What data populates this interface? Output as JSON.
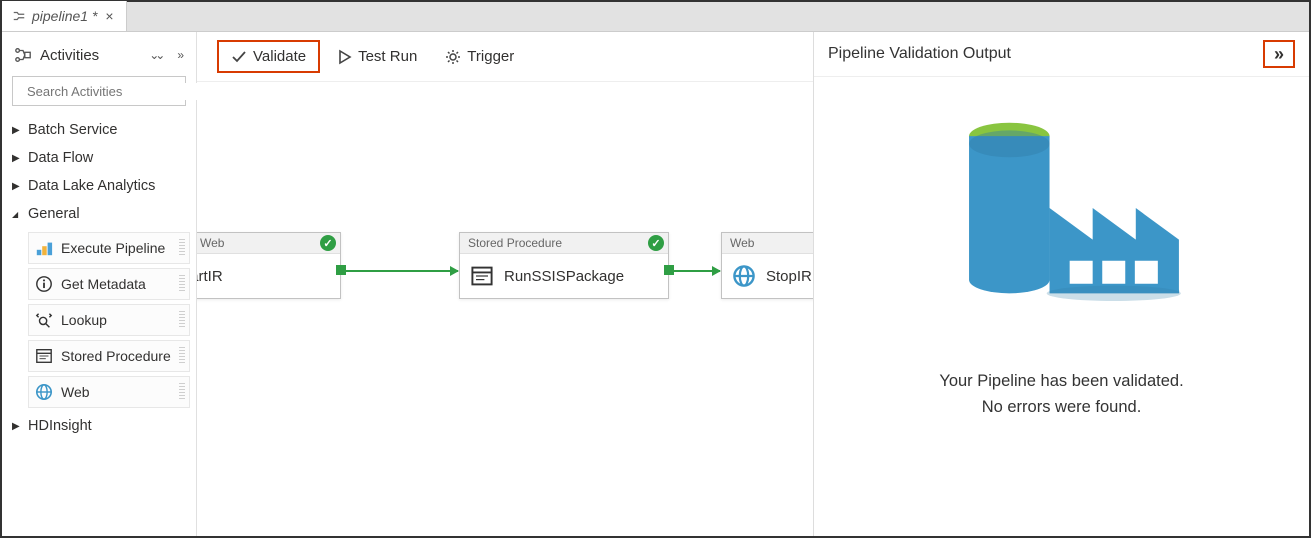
{
  "tab": {
    "title": "pipeline1 *"
  },
  "sidebar": {
    "title": "Activities",
    "search_placeholder": "Search Activities",
    "groups": [
      {
        "label": "Batch Service",
        "expanded": false
      },
      {
        "label": "Data Flow",
        "expanded": false
      },
      {
        "label": "Data Lake Analytics",
        "expanded": false
      },
      {
        "label": "General",
        "expanded": true
      },
      {
        "label": "HDInsight",
        "expanded": false
      }
    ],
    "general_items": [
      {
        "label": "Execute Pipeline",
        "icon": "execute-pipeline-icon"
      },
      {
        "label": "Get Metadata",
        "icon": "info-icon"
      },
      {
        "label": "Lookup",
        "icon": "lookup-icon"
      },
      {
        "label": "Stored Procedure",
        "icon": "stored-procedure-icon"
      },
      {
        "label": "Web",
        "icon": "web-icon"
      }
    ]
  },
  "toolbar": {
    "validate_label": "Validate",
    "testrun_label": "Test Run",
    "trigger_label": "Trigger"
  },
  "nodes": [
    {
      "type_label": "Web",
      "name": "StartIR",
      "status": "success",
      "icon": "web-icon"
    },
    {
      "type_label": "Stored Procedure",
      "name": "RunSSISPackage",
      "status": "success",
      "icon": "stored-procedure-icon"
    },
    {
      "type_label": "Web",
      "name": "StopIR",
      "status": "none",
      "icon": "web-icon"
    }
  ],
  "right_panel": {
    "title": "Pipeline Validation Output",
    "message_line1": "Your Pipeline has been validated.",
    "message_line2": "No errors were found."
  },
  "colors": {
    "success_green": "#2f9e44",
    "highlight_red": "#d83b01",
    "factory_blue": "#3c96c8",
    "factory_green": "#89c540"
  }
}
